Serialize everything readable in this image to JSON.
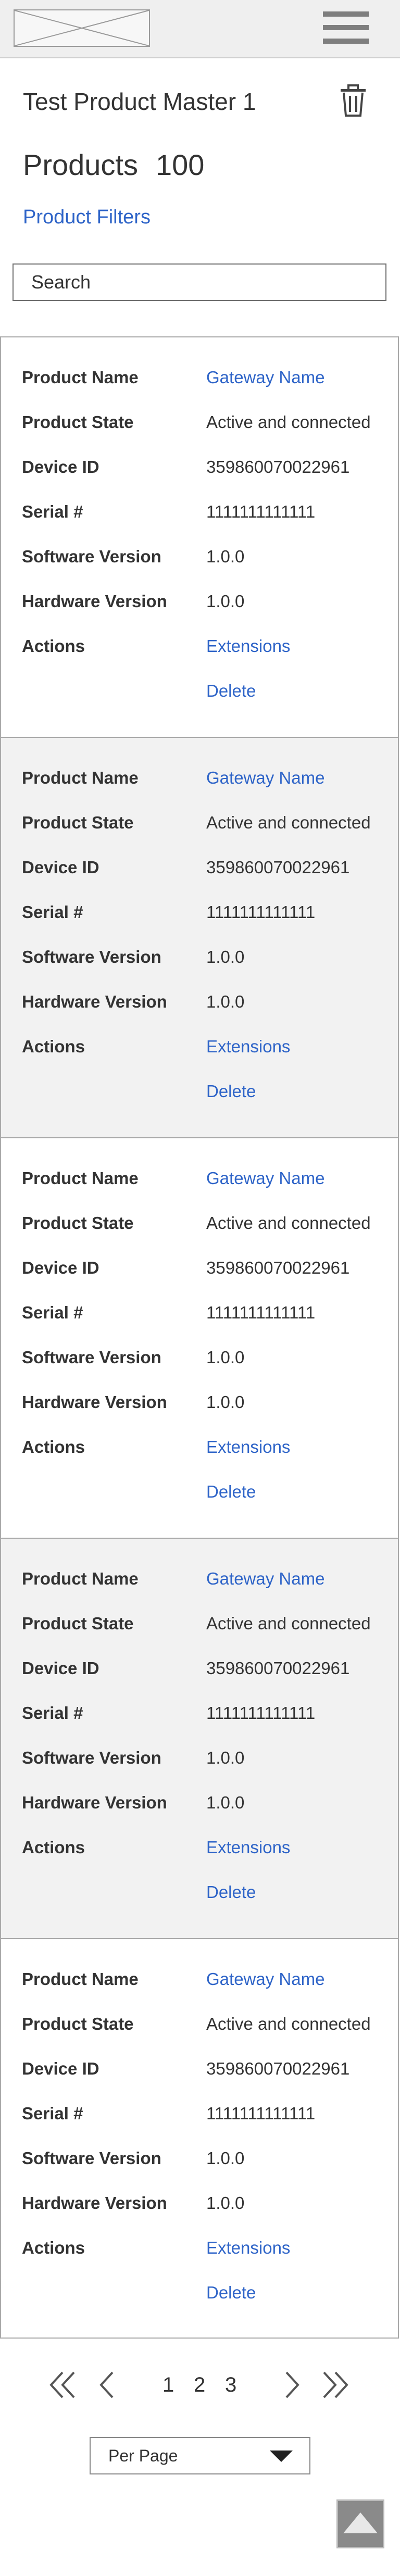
{
  "header": {
    "logo_icon": "logo-placeholder-icon",
    "menu_icon": "hamburger-menu-icon"
  },
  "page": {
    "title": "Test Product Master 1",
    "delete_icon": "trash-icon"
  },
  "products": {
    "label": "Products",
    "count": "100"
  },
  "filters": {
    "link_label": "Product Filters"
  },
  "search": {
    "placeholder": "Search"
  },
  "field_labels": {
    "name": "Product Name",
    "state": "Product State",
    "device_id": "Device ID",
    "serial": "Serial #",
    "software": "Software Version",
    "hardware": "Hardware Version",
    "actions": "Actions"
  },
  "products_list": [
    {
      "name": "Gateway Name",
      "state": "Active and connected",
      "device_id": "359860070022961",
      "serial": "1111111111111",
      "software": "1.0.0",
      "hardware": "1.0.0",
      "action_extensions": "Extensions",
      "action_delete": "Delete"
    },
    {
      "name": "Gateway Name",
      "state": "Active and connected",
      "device_id": "359860070022961",
      "serial": "1111111111111",
      "software": "1.0.0",
      "hardware": "1.0.0",
      "action_extensions": "Extensions",
      "action_delete": "Delete"
    },
    {
      "name": "Gateway Name",
      "state": "Active and connected",
      "device_id": "359860070022961",
      "serial": "1111111111111",
      "software": "1.0.0",
      "hardware": "1.0.0",
      "action_extensions": "Extensions",
      "action_delete": "Delete"
    },
    {
      "name": "Gateway Name",
      "state": "Active and connected",
      "device_id": "359860070022961",
      "serial": "1111111111111",
      "software": "1.0.0",
      "hardware": "1.0.0",
      "action_extensions": "Extensions",
      "action_delete": "Delete"
    },
    {
      "name": "Gateway Name",
      "state": "Active and connected",
      "device_id": "359860070022961",
      "serial": "1111111111111",
      "software": "1.0.0",
      "hardware": "1.0.0",
      "action_extensions": "Extensions",
      "action_delete": "Delete"
    }
  ],
  "pagination": {
    "pages": [
      "1",
      "2",
      "3"
    ],
    "first_icon": "double-chevron-left-icon",
    "prev_icon": "chevron-left-icon",
    "next_icon": "chevron-right-icon",
    "last_icon": "double-chevron-right-icon"
  },
  "per_page": {
    "label": "Per Page",
    "icon": "caret-down-icon"
  },
  "back_to_top": {
    "icon": "arrow-up-icon"
  },
  "colors": {
    "link": "#2e64c8",
    "header_bg": "#efefef",
    "alt_card_bg": "#f2f2f2",
    "text": "#333333"
  }
}
